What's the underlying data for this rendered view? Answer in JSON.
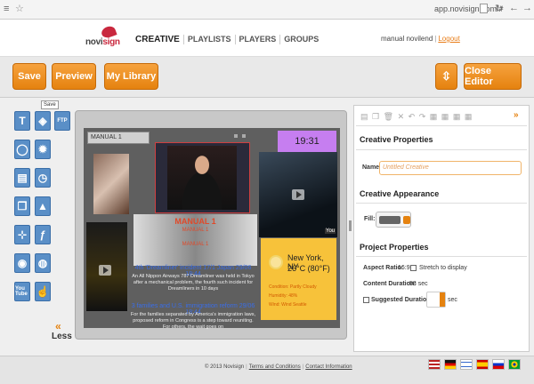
{
  "browser": {
    "url": "app.novisign.com/#"
  },
  "brand": {
    "name_prefix": "novi",
    "name_suffix": "sign"
  },
  "nav": {
    "items": [
      "CREATIVE",
      "PLAYLISTS",
      "PLAYERS",
      "GROUPS"
    ]
  },
  "user": {
    "name": "manual novilend",
    "logout": "Logout"
  },
  "toolbar": {
    "save": "Save",
    "preview": "Preview",
    "library": "My Library",
    "close_editor": "Close Editor",
    "tooltip": "Save"
  },
  "tools": {
    "ftp": "FTP",
    "youtube": "You Tube",
    "less": "Less"
  },
  "canvas": {
    "label": "MANUAL 1",
    "clock": "19:31",
    "manual_big": "MANUAL 1",
    "manual_small_1": "MANUAL 1",
    "manual_small_2": "MANUAL 1",
    "weather_city": "New York, NY",
    "weather_temp": "26°C (80°F)",
    "weather_cond": "Condition: Partly Cloudy",
    "weather_hum": "Humidity: 48%",
    "weather_wind": "Wind: Wind Seattle",
    "news_h1": "4th 'Dreamliner' incident 17/1 Japan 29/06 18:44",
    "news_p1": "An All Nippon Airways 787 Dreamliner was held in Tokyo after a mechanical problem, the fourth such incident for Dreamliners in 10 days",
    "news_h2": "3 families and U.S. immigration reform 29/06 18:44",
    "news_p2": "For the families separated by America's immigration laws, proposed reform in Congress is a step toward reuniting. For others, the wait goes on"
  },
  "panel": {
    "creative_properties": "Creative Properties",
    "name_label": "Name:",
    "name_placeholder": "Untitled Creative",
    "appearance": "Creative Appearance",
    "fill_label": "Fill:",
    "project_properties": "Project Properties",
    "aspect_label": "Aspect Ratio:",
    "aspect_value": "16:9",
    "stretch": "Stretch to display",
    "content_label": "Content Duration:",
    "content_value": "58 sec",
    "suggested_label": "Suggested Duration:",
    "suggested_unit": "sec"
  },
  "footer": {
    "copyright": "© 2013 Novisign",
    "terms": "Terms and Conditions",
    "contact": "Contact Information"
  },
  "colors": {
    "accent": "#e5820f",
    "tool_blue": "#5a8fc7",
    "clock_bg": "#c67ef0",
    "weather_bg": "#f7c23a"
  }
}
